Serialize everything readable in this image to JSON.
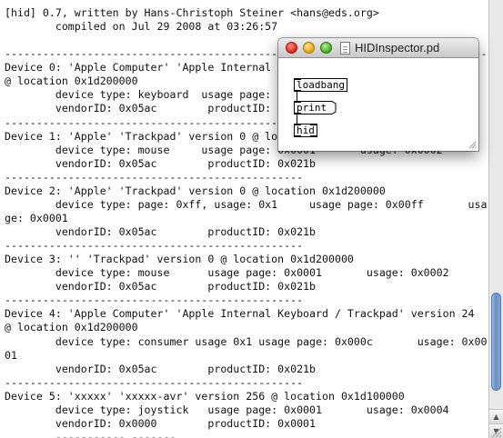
{
  "console": {
    "lines": [
      "[hid] 0.7, written by Hans-Christoph Steiner <hans@eds.org>",
      "        compiled on Jul 29 2008 at 03:26:57",
      "",
      "--------------------------------------------------------------------------------",
      "Device 0: 'Apple Computer' 'Apple Internal Keyboard / Trackpad' version 24",
      "@ location 0x1d200000",
      "        device type: keyboard  usage page: 0x0001       usage: 0x0006",
      "        vendorID: 0x05ac        productID: 0x021b",
      "-----------------------------------------------",
      "Device 1: 'Apple' 'Trackpad' version 0 @ location 0x1d200000",
      "        device type: mouse     usage page: 0x0001       usage: 0x0002",
      "        vendorID: 0x05ac        productID: 0x021b",
      "-----------------------------------------------",
      "Device 2: 'Apple' 'Trackpad' version 0 @ location 0x1d200000",
      "        device type: page: 0xff, usage: 0x1     usage page: 0x00ff       usa",
      "ge: 0x0001",
      "        vendorID: 0x05ac        productID: 0x021b",
      "-----------------------------------------------",
      "Device 3: '' 'Trackpad' version 0 @ location 0x1d200000",
      "        device type: mouse      usage page: 0x0001       usage: 0x0002",
      "        vendorID: 0x05ac        productID: 0x021b",
      "-----------------------------------------------",
      "Device 4: 'Apple Computer' 'Apple Internal Keyboard / Trackpad' version 24",
      "@ location 0x1d200000",
      "        device type: consumer usage 0x1 usage page: 0x000c       usage: 0x00",
      "01",
      "        vendorID: 0x05ac        productID: 0x021b",
      "-----------------------------------------------",
      "Device 5: 'xxxxx' 'xxxxx-avr' version 256 @ location 0x1d100000",
      "        device type: joystick   usage page: 0x0001       usage: 0x0004",
      "        vendorID: 0x0000        productID: 0x0001",
      "        ----------- -------"
    ]
  },
  "pd_window": {
    "title": "HIDInspector.pd",
    "objects": {
      "loadbang": "loadbang",
      "print": "print",
      "hid": "hid"
    }
  },
  "icons": {
    "close": "close-button-red",
    "minimize": "minimize-button-yellow",
    "zoom": "zoom-button-green",
    "document": "document-icon",
    "resize": "resize-grip-icon"
  }
}
